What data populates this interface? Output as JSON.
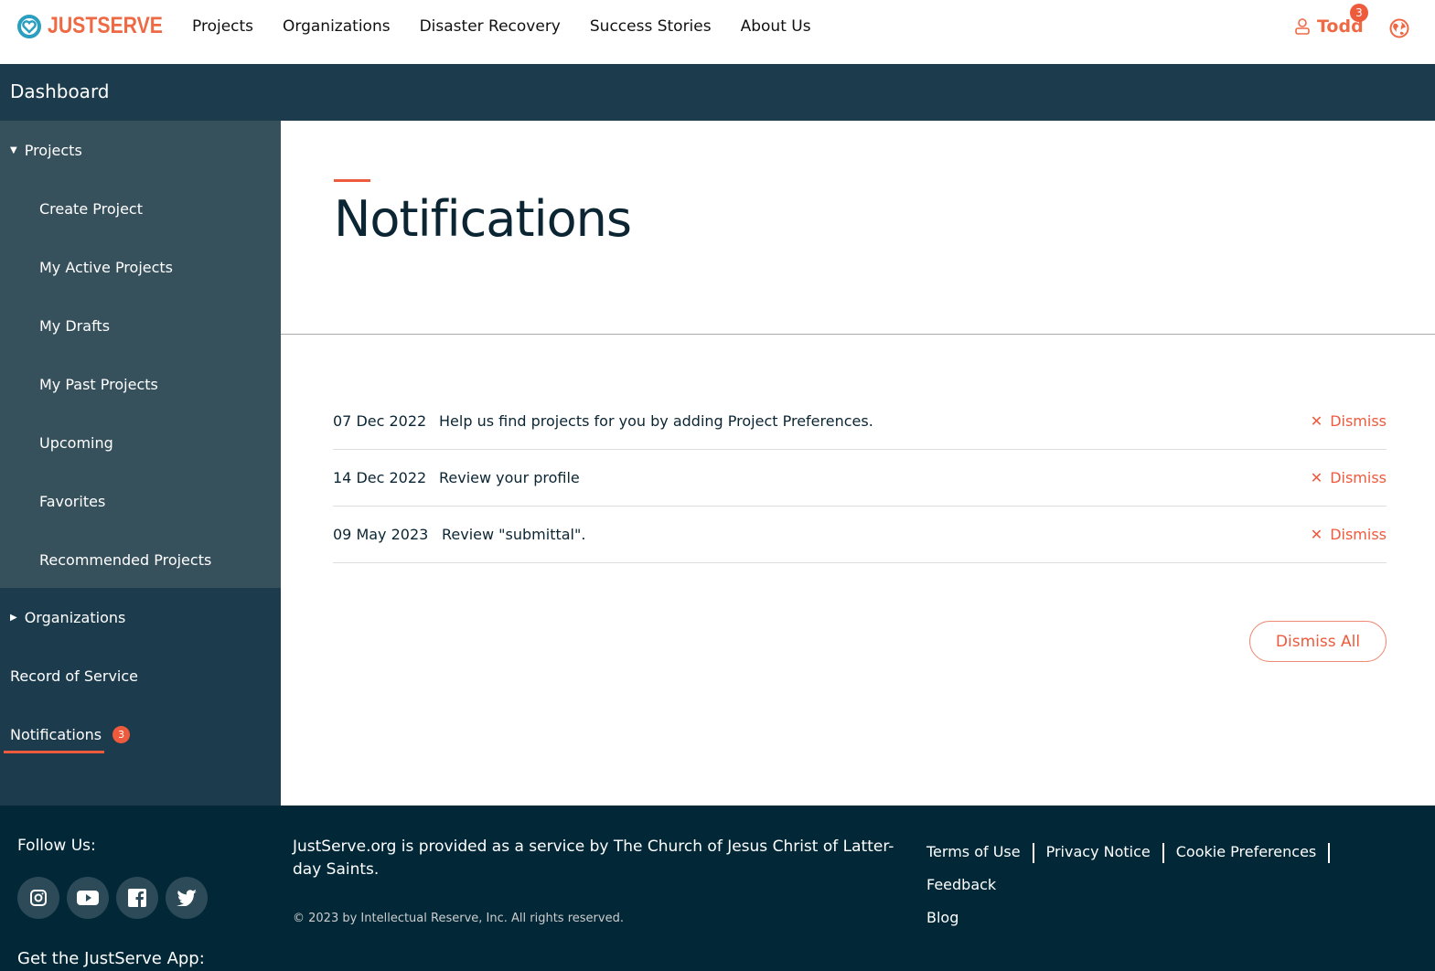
{
  "brand": {
    "name": "JustServe",
    "accent": "#ee5a3c",
    "navy": "#1c3c4e"
  },
  "nav": [
    "Projects",
    "Organizations",
    "Disaster Recovery",
    "Success Stories",
    "About Us"
  ],
  "user": {
    "name": "Todd",
    "badge": "3"
  },
  "dashboard": {
    "title": "Dashboard"
  },
  "sidebar": {
    "projects": "Projects",
    "project_items": [
      "Create Project",
      "My Active Projects",
      "My Drafts",
      "My Past Projects",
      "Upcoming",
      "Favorites",
      "Recommended Projects"
    ],
    "organizations": "Organizations",
    "record": "Record of Service",
    "notifications": "Notifications",
    "notifications_badge": "3"
  },
  "main": {
    "title": "Notifications",
    "notifications": [
      {
        "date": "07 Dec 2022",
        "message": "Help us find projects for you by adding Project Preferences.",
        "action": "Dismiss"
      },
      {
        "date": "14 Dec 2022",
        "message": "Review your profile",
        "action": "Dismiss"
      },
      {
        "date": "09 May 2023",
        "message": "Review \"submittal\".",
        "action": "Dismiss"
      }
    ],
    "dismiss_all": "Dismiss All"
  },
  "footer": {
    "follow": "Follow Us:",
    "social": [
      "instagram-icon",
      "youtube-icon",
      "facebook-icon",
      "twitter-icon"
    ],
    "get_app": "Get the JustServe App:",
    "provided": "JustServe.org is provided as a service by The Church of Jesus Christ of Latter-day Saints.",
    "copyright": "© 2023 by Intellectual Reserve, Inc. All rights reserved.",
    "links": [
      "Terms of Use",
      "Privacy Notice",
      "Cookie Preferences",
      "Feedback",
      "Blog"
    ]
  }
}
